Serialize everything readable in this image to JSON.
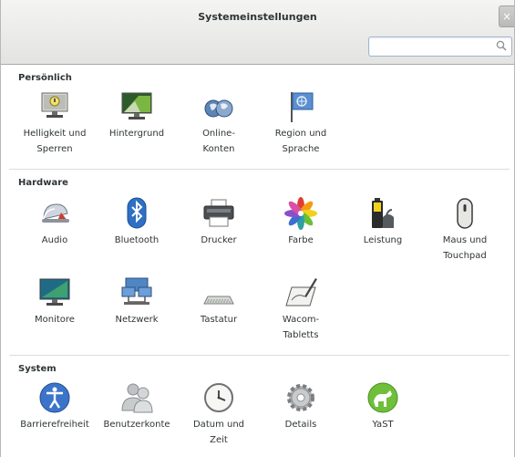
{
  "window": {
    "title": "Systemeinstellungen",
    "close_glyph": "×"
  },
  "search": {
    "value": "",
    "placeholder": "",
    "icon": "search-icon"
  },
  "sections": {
    "personal": {
      "title": "Persönlich",
      "items": [
        {
          "label": "Helligkeit und\nSperren",
          "icon": "brightness-lock-icon"
        },
        {
          "label": "Hintergrund",
          "icon": "background-icon"
        },
        {
          "label": "Online-\nKonten",
          "icon": "online-accounts-icon"
        },
        {
          "label": "Region und\nSprache",
          "icon": "region-language-icon"
        }
      ]
    },
    "hardware": {
      "title": "Hardware",
      "items": [
        {
          "label": "Audio",
          "icon": "audio-icon"
        },
        {
          "label": "Bluetooth",
          "icon": "bluetooth-icon"
        },
        {
          "label": "Drucker",
          "icon": "printer-icon"
        },
        {
          "label": "Farbe",
          "icon": "color-icon"
        },
        {
          "label": "Leistung",
          "icon": "power-icon"
        },
        {
          "label": "Maus und\nTouchpad",
          "icon": "mouse-icon"
        },
        {
          "label": "Monitore",
          "icon": "monitor-icon"
        },
        {
          "label": "Netzwerk",
          "icon": "network-icon"
        },
        {
          "label": "Tastatur",
          "icon": "keyboard-icon"
        },
        {
          "label": "Wacom-\nTabletts",
          "icon": "wacom-tablet-icon"
        }
      ]
    },
    "system": {
      "title": "System",
      "items": [
        {
          "label": "Barrierefreiheit",
          "icon": "accessibility-icon"
        },
        {
          "label": "Benutzerkonte",
          "icon": "user-accounts-icon"
        },
        {
          "label": "Datum und\nZeit",
          "icon": "clock-icon"
        },
        {
          "label": "Details",
          "icon": "details-gear-icon"
        },
        {
          "label": "YaST",
          "icon": "yast-icon"
        }
      ]
    }
  }
}
